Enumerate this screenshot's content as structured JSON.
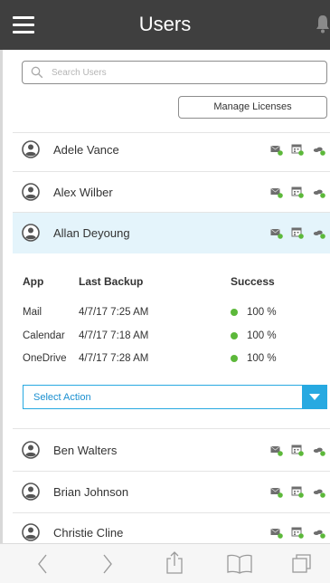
{
  "header": {
    "title": "Users",
    "menu_icon": "hamburger-menu-icon",
    "bell_icon": "bell-icon"
  },
  "search": {
    "placeholder": "Search Users",
    "value": ""
  },
  "manage_licenses_label": "Manage Licenses",
  "users": [
    {
      "name": "Adele Vance"
    },
    {
      "name": "Alex Wilber"
    },
    {
      "name": "Allan Deyoung"
    },
    {
      "name": "Ben Walters"
    },
    {
      "name": "Brian Johnson"
    },
    {
      "name": "Christie Cline"
    }
  ],
  "detail": {
    "headers": {
      "app": "App",
      "last_backup": "Last Backup",
      "success": "Success"
    },
    "rows": [
      {
        "app": "Mail",
        "last_backup": "4/7/17 7:25 AM",
        "success": "100 %"
      },
      {
        "app": "Calendar",
        "last_backup": "4/7/17 7:18 AM",
        "success": "100 %"
      },
      {
        "app": "OneDrive",
        "last_backup": "4/7/17 7:28 AM",
        "success": "100 %"
      }
    ],
    "select_action_label": "Select Action"
  },
  "colors": {
    "header_bg": "#3f3f3f",
    "accent": "#27a9e1",
    "selected_row": "#e4f4fb",
    "success_green": "#5cb83a",
    "icon_gray": "#6e6e6e"
  }
}
